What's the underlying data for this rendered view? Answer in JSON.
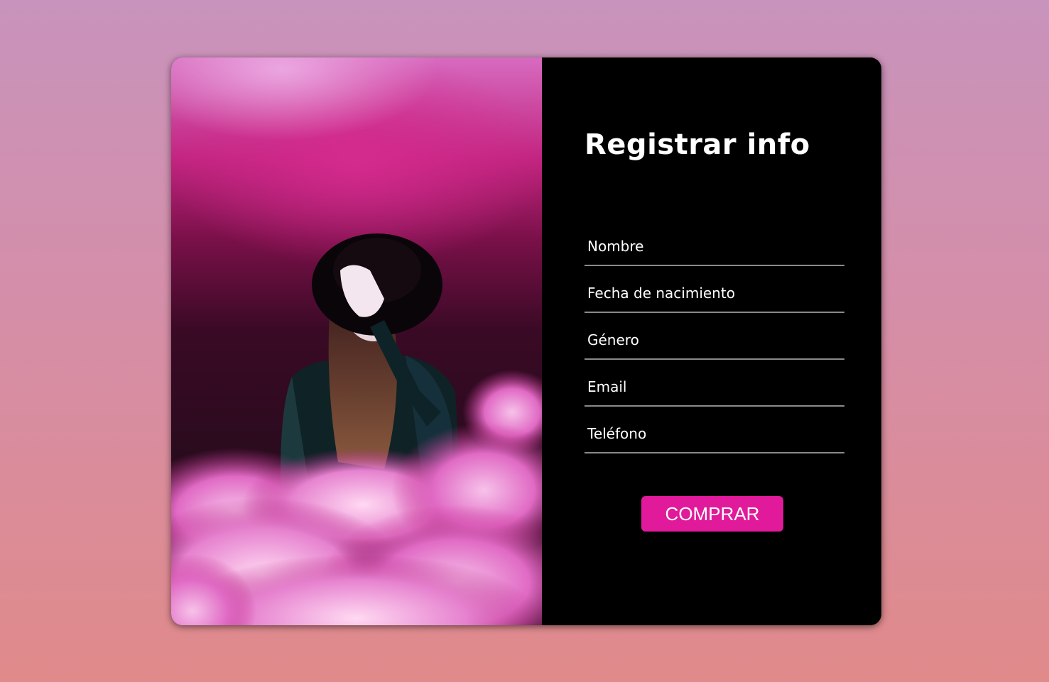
{
  "form": {
    "title": "Registrar info",
    "fields": [
      {
        "placeholder": "Nombre",
        "value": ""
      },
      {
        "placeholder": "Fecha de nacimiento",
        "value": ""
      },
      {
        "placeholder": "Género",
        "value": ""
      },
      {
        "placeholder": "Email",
        "value": ""
      },
      {
        "placeholder": "Teléfono",
        "value": ""
      }
    ],
    "submit_label": "COMPRAR"
  },
  "colors": {
    "accent": "#e01a9a",
    "panel_background": "#000000",
    "text": "#ffffff",
    "field_underline": "#8a8a8a"
  }
}
